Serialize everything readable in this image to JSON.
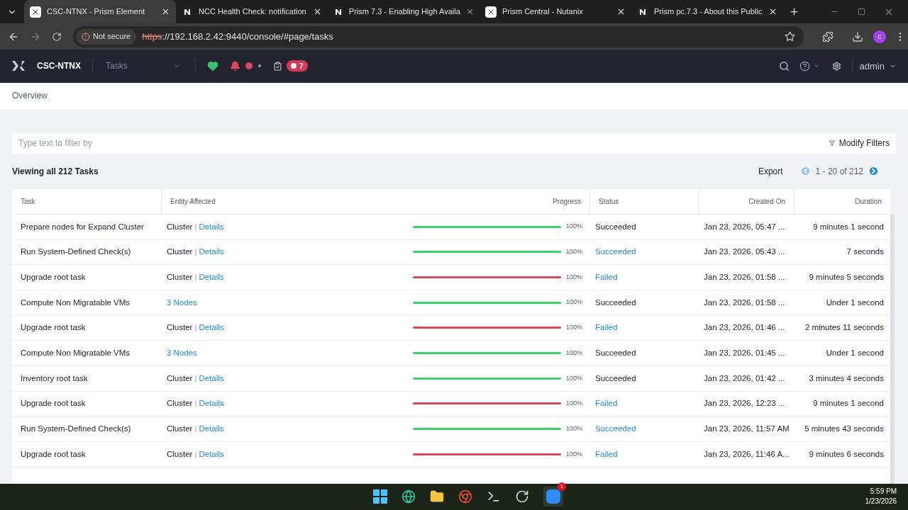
{
  "browser": {
    "tabs": [
      {
        "title": "CSC-NTNX - Prism Element",
        "kind": "x",
        "selected": true
      },
      {
        "title": "NCC Health Check: notification",
        "kind": "n",
        "selected": false
      },
      {
        "title": "Prism 7.3 - Enabling High Availa",
        "kind": "n",
        "selected": false
      },
      {
        "title": "Prism Central - Nutanix",
        "kind": "x",
        "selected": false
      },
      {
        "title": "Prism pc.7.3 - About this Public",
        "kind": "n",
        "selected": false
      }
    ],
    "security": "Not secure",
    "url_scheme": "https",
    "url_rest": "://192.168.2.42:9440/console/#page/tasks",
    "profile": "c"
  },
  "app": {
    "cluster": "CSC-NTNX",
    "page": "Tasks",
    "task_count": "7",
    "user": "admin"
  },
  "breadcrumb": "Overview",
  "filter": {
    "placeholder": "Type text to filter by",
    "modify": "Modify Filters"
  },
  "summary": "Viewing all 212 Tasks",
  "export": "Export",
  "pagination": "1 - 20 of 212",
  "table": {
    "columns": [
      "Task",
      "Entity Affected",
      "Progress",
      "Status",
      "Created On",
      "Duration"
    ],
    "rows": [
      {
        "task": "Prepare nodes for Expand Cluster",
        "kind": "cluster",
        "entity": "Cluster",
        "separator": "|",
        "entity_link": "Details",
        "level": 1,
        "color": "#3fd16b",
        "progress": "100%",
        "status": "Succeeded",
        "status_link": false,
        "created": "Jan 23, 2026, 05:47 ...",
        "duration": "9 minutes 1 second"
      },
      {
        "task": "Run System-Defined Check(s)",
        "kind": "cluster",
        "entity": "Cluster",
        "separator": "|",
        "entity_link": "Details",
        "level": 1,
        "color": "#3fd16b",
        "progress": "100%",
        "status": "Succeeded",
        "status_link": true,
        "created": "Jan 23, 2026, 05:43 ...",
        "duration": "7 seconds"
      },
      {
        "task": "Upgrade root task",
        "kind": "cluster",
        "entity": "Cluster",
        "separator": "|",
        "entity_link": "Details",
        "level": 1,
        "color": "#d9475e",
        "progress": "100%",
        "status": "Failed",
        "status_link": true,
        "created": "Jan 23, 2026, 01:58 ...",
        "duration": "9 minutes 5 seconds"
      },
      {
        "task": "Compute Non Migratable VMs",
        "kind": "nodes",
        "entity_link": "3 Nodes",
        "level": 1,
        "color": "#3fd16b",
        "progress": "100%",
        "status": "Succeeded",
        "status_link": false,
        "created": "Jan 23, 2026, 01:58 ...",
        "duration": "Under 1 second"
      },
      {
        "task": "Upgrade root task",
        "kind": "cluster",
        "entity": "Cluster",
        "separator": "|",
        "entity_link": "Details",
        "level": 1,
        "color": "#d9475e",
        "progress": "100%",
        "status": "Failed",
        "status_link": true,
        "created": "Jan 23, 2026, 01:46 ...",
        "duration": "2 minutes 11 seconds"
      },
      {
        "task": "Compute Non Migratable VMs",
        "kind": "nodes",
        "entity_link": "3 Nodes",
        "level": 1,
        "color": "#3fd16b",
        "progress": "100%",
        "status": "Succeeded",
        "status_link": false,
        "created": "Jan 23, 2026, 01:45 ...",
        "duration": "Under 1 second"
      },
      {
        "task": "Inventory root task",
        "kind": "cluster",
        "entity": "Cluster",
        "separator": "|",
        "entity_link": "Details",
        "level": 1,
        "color": "#3fd16b",
        "progress": "100%",
        "status": "Succeeded",
        "status_link": false,
        "created": "Jan 23, 2026, 01:42 ...",
        "duration": "3 minutes 4 seconds"
      },
      {
        "task": "Upgrade root task",
        "kind": "cluster",
        "entity": "Cluster",
        "separator": "|",
        "entity_link": "Details",
        "level": 1,
        "color": "#d9475e",
        "progress": "100%",
        "status": "Failed",
        "status_link": true,
        "created": "Jan 23, 2026, 12:23 ...",
        "duration": "9 minutes 1 second"
      },
      {
        "task": "Run System-Defined Check(s)",
        "kind": "cluster",
        "entity": "Cluster",
        "separator": "|",
        "entity_link": "Details",
        "level": 1,
        "color": "#3fd16b",
        "progress": "100%",
        "status": "Succeeded",
        "status_link": true,
        "created": "Jan 23, 2026, 11:57 AM",
        "duration": "5 minutes 43 seconds"
      },
      {
        "task": "Upgrade root task",
        "kind": "cluster",
        "entity": "Cluster",
        "separator": "|",
        "entity_link": "Details",
        "level": 1,
        "color": "#d9475e",
        "progress": "100%",
        "status": "Failed",
        "status_link": true,
        "created": "Jan 23, 2026, 11:46 A...",
        "duration": "9 minutes 6 seconds"
      }
    ]
  },
  "taskbar": {
    "zoom_badge": "1",
    "time": "5:59 PM",
    "date": "1/23/2026"
  }
}
